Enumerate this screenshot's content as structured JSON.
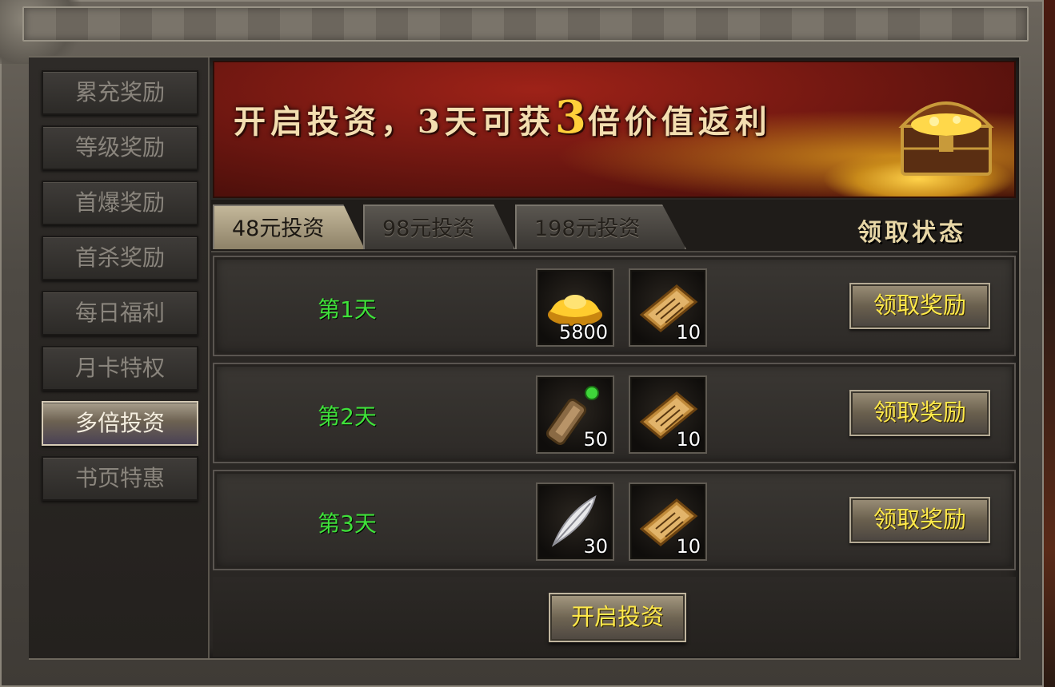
{
  "sidebar": {
    "items": [
      {
        "label": "累充奖励",
        "active": false
      },
      {
        "label": "等级奖励",
        "active": false
      },
      {
        "label": "首爆奖励",
        "active": false
      },
      {
        "label": "首杀奖励",
        "active": false
      },
      {
        "label": "每日福利",
        "active": false
      },
      {
        "label": "月卡特权",
        "active": false
      },
      {
        "label": "多倍投资",
        "active": true
      },
      {
        "label": "书页特惠",
        "active": false
      }
    ]
  },
  "banner": {
    "title_part1": "开启投资，3天可获",
    "title_highlight": "3",
    "title_part2": "倍价值返利",
    "chest_icon": "treasure-chest-icon"
  },
  "tabs": [
    {
      "label": "48元投资",
      "active": true
    },
    {
      "label": "98元投资",
      "active": false
    },
    {
      "label": "198元投资",
      "active": false
    }
  ],
  "status_header": "领取状态",
  "rows": [
    {
      "day": "第1天",
      "items": [
        {
          "icon": "gold-ingot-icon",
          "count": "5800"
        },
        {
          "icon": "book-page-icon",
          "count": "10"
        }
      ],
      "claim_label": "领取奖励"
    },
    {
      "day": "第2天",
      "items": [
        {
          "icon": "scroll-icon",
          "count": "50"
        },
        {
          "icon": "book-page-icon",
          "count": "10"
        }
      ],
      "claim_label": "领取奖励"
    },
    {
      "day": "第3天",
      "items": [
        {
          "icon": "feather-icon",
          "count": "30"
        },
        {
          "icon": "book-page-icon",
          "count": "10"
        }
      ],
      "claim_label": "领取奖励"
    }
  ],
  "open_button_label": "开启投资",
  "colors": {
    "day_label": "#3fe13a",
    "button_text": "#ffe94a",
    "banner_red": "#9e2218"
  }
}
